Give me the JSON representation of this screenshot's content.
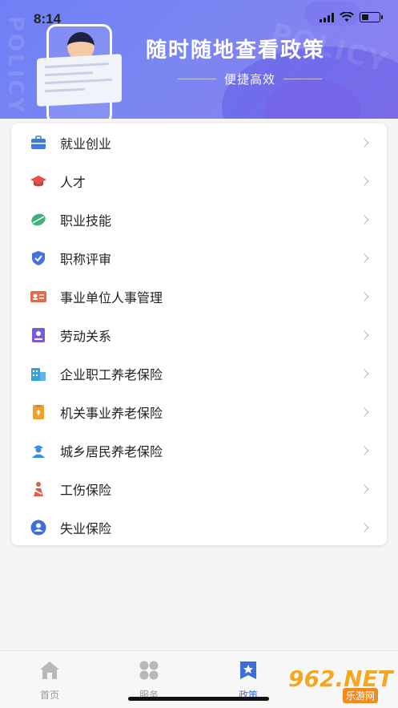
{
  "status_bar": {
    "time": "8:14"
  },
  "banner": {
    "title": "随时随地查看政策",
    "subtitle": "便捷高效",
    "watermark_left": "POLICY",
    "watermark_right": "POLICY"
  },
  "menu": {
    "items": [
      {
        "label": "就业创业",
        "icon": "briefcase-icon",
        "color": "#3d7be0"
      },
      {
        "label": "人才",
        "icon": "graduation-cap-icon",
        "color": "#e2504a"
      },
      {
        "label": "职业技能",
        "icon": "skill-icon",
        "color": "#3bb37a"
      },
      {
        "label": "职称评审",
        "icon": "shield-check-icon",
        "color": "#4a6fe0"
      },
      {
        "label": "事业单位人事管理",
        "icon": "id-card-icon",
        "color": "#e56a4a"
      },
      {
        "label": "劳动关系",
        "icon": "contract-icon",
        "color": "#7a5be0"
      },
      {
        "label": "企业职工养老保险",
        "icon": "building-icon",
        "color": "#3aa0d8"
      },
      {
        "label": "机关事业养老保险",
        "icon": "badge-icon",
        "color": "#f0a02a"
      },
      {
        "label": "城乡居民养老保险",
        "icon": "farmer-icon",
        "color": "#3d8be0"
      },
      {
        "label": "工伤保险",
        "icon": "injury-icon",
        "color": "#e25a4a"
      },
      {
        "label": "失业保险",
        "icon": "person-circle-icon",
        "color": "#3d6fe0"
      }
    ]
  },
  "tabbar": {
    "tabs": [
      {
        "label": "首页",
        "icon": "home-icon",
        "active": false
      },
      {
        "label": "服务",
        "icon": "services-icon",
        "active": false
      },
      {
        "label": "政策",
        "icon": "policy-icon",
        "active": true
      }
    ],
    "active_color": "#3b6fd6"
  },
  "watermark_logo": {
    "big": "962.NET",
    "small": "乐游网"
  }
}
